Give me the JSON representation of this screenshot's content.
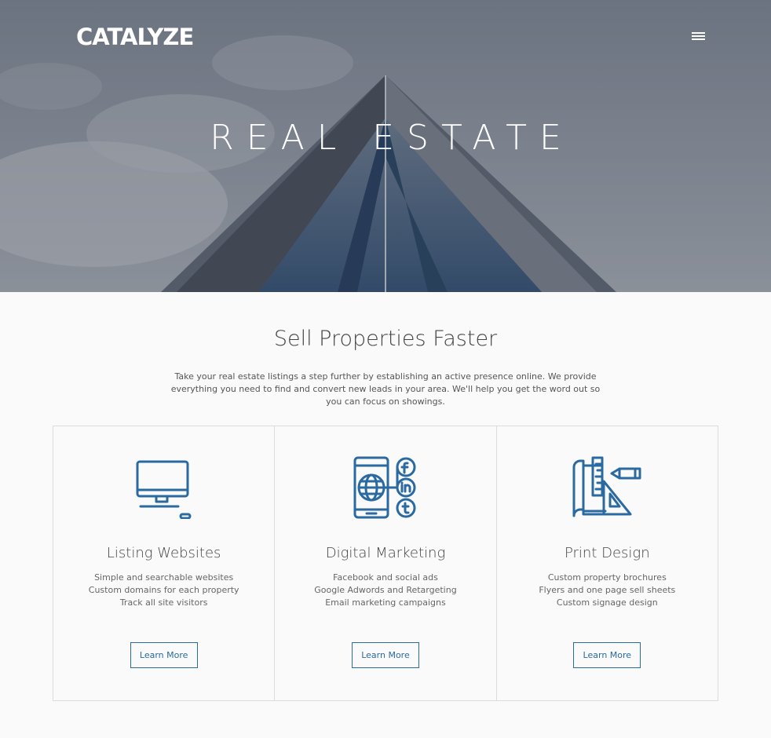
{
  "header": {
    "logo_text": "CATALYZE",
    "menu_icon": "hamburger-menu-icon",
    "hero_title": "REAL ESTATE"
  },
  "intro": {
    "heading": "Sell Properties Faster",
    "body": "Take your real estate listings a step further by establishing an active presence online. We provide everything you need to find and convert new leads in your area. We'll help you get the word out so you can focus on showings."
  },
  "cards": [
    {
      "icon": "desktop-computer-icon",
      "title": "Listing Websites",
      "lines": [
        "Simple and searchable websites",
        "Custom domains for each property",
        "Track all site visitors"
      ],
      "button": "Learn More"
    },
    {
      "icon": "mobile-social-media-icon",
      "title": "Digital Marketing",
      "lines": [
        "Facebook and social ads",
        "Google Adwords and Retargeting",
        "Email marketing campaigns"
      ],
      "button": "Learn More"
    },
    {
      "icon": "print-design-icon",
      "title": "Print Design",
      "lines": [
        "Custom property brochures",
        "Flyers and one page sell sheets",
        "Custom signage design"
      ],
      "button": "Learn More"
    }
  ],
  "colors": {
    "accent": "#2a6aa0",
    "background": "#fafafa",
    "border": "#dcdcdc"
  }
}
